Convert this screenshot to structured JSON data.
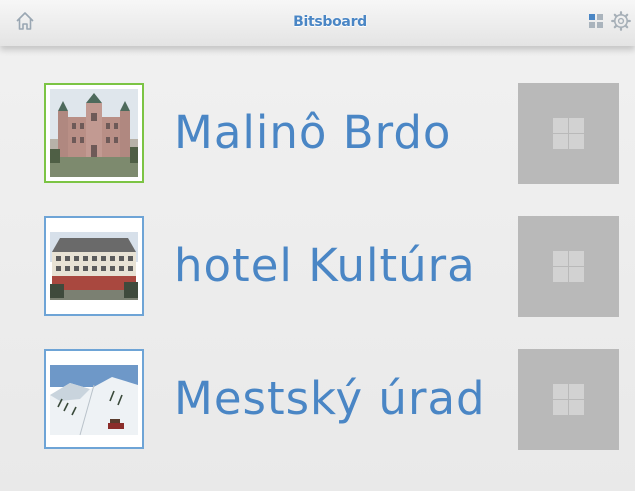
{
  "header": {
    "title": "Bitsboard",
    "icons": {
      "home": "home-icon",
      "grid": "grid-icon",
      "settings": "gear-icon"
    }
  },
  "words": [
    {
      "label": "Malinô Brdo",
      "selected": true,
      "image": "castle-photo"
    },
    {
      "label": "hotel Kultúra",
      "selected": false,
      "image": "hotel-photo"
    },
    {
      "label": "Mestský úrad",
      "selected": false,
      "image": "ski-slope-photo"
    }
  ],
  "colors": {
    "accent": "#4a86c5",
    "selected_border": "#7cc444",
    "border": "#6ea4d6",
    "tile": "#b9b9b9"
  }
}
